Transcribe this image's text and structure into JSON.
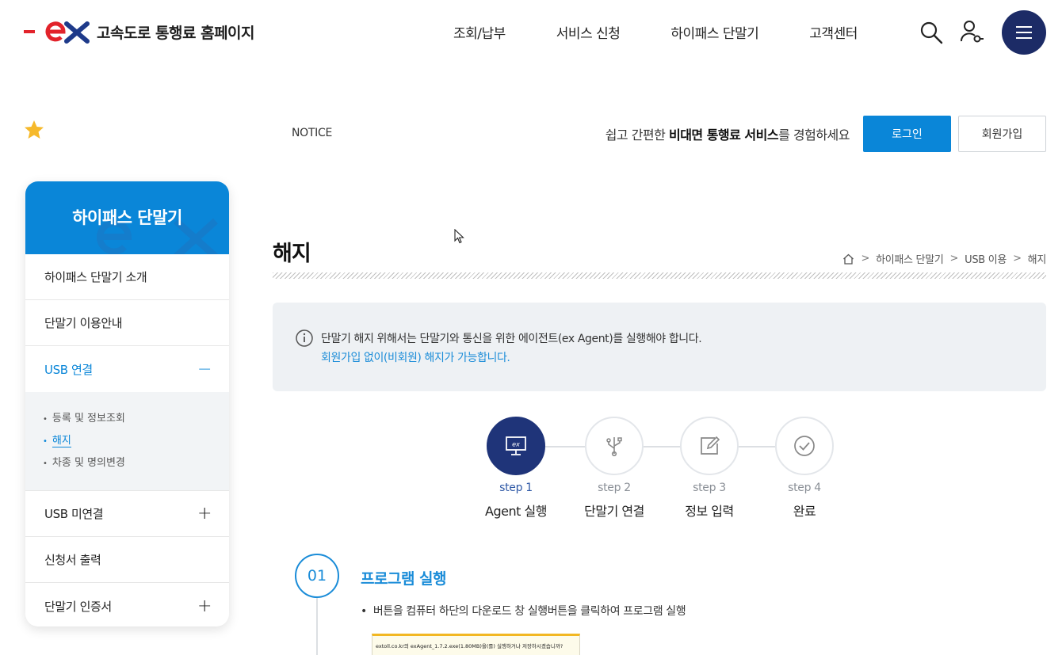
{
  "header": {
    "logo_text": "고속도로 통행료 홈페이지",
    "logo_colors": {
      "red": "#e2232b",
      "blue": "#1e3a8a"
    },
    "nav": [
      "조회/납부",
      "서비스 신청",
      "하이패스 단말기",
      "고객센터"
    ],
    "icons": [
      "search-icon",
      "user-key-icon",
      "menu-icon"
    ],
    "menu_button_color": "#1c2b66"
  },
  "notice": {
    "label": "NOTICE",
    "message_prefix": "쉽고 간편한 ",
    "message_bold": "비대면 통행료 서비스",
    "message_suffix": "를 경험하세요",
    "login_label": "로그인",
    "join_label": "회원가입",
    "accent": "#0a86d8"
  },
  "sidebar": {
    "title": "하이패스 단말기",
    "items": [
      {
        "label": "하이패스 단말기 소개",
        "toggle": ""
      },
      {
        "label": "단말기 이용안내",
        "toggle": ""
      },
      {
        "label": "USB 연결",
        "toggle": "−"
      },
      {
        "label": "USB 미연결",
        "toggle": "+"
      },
      {
        "label": "신청서 출력",
        "toggle": ""
      },
      {
        "label": "단말기 인증서",
        "toggle": "+"
      }
    ],
    "submenu": [
      "등록 및 정보조회",
      "해지",
      "차종 및 명의변경"
    ],
    "current_sub": "해지"
  },
  "page": {
    "title": "해지",
    "breadcrumb": [
      "하이패스 단말기",
      "USB 이용",
      "해지"
    ]
  },
  "info": {
    "line1": "단말기 해지 위해서는 단말기와 통신을 위한 에이전트(ex Agent)를 실행해야 합니다.",
    "line2": "회원가입 없이(비회원) 해지가 가능합니다."
  },
  "steps": [
    {
      "num": "step 1",
      "name": "Agent 실행",
      "icon": "ex-monitor-icon",
      "active": true
    },
    {
      "num": "step 2",
      "name": "단말기 연결",
      "icon": "usb-icon",
      "active": false
    },
    {
      "num": "step 3",
      "name": "정보 입력",
      "icon": "edit-icon",
      "active": false
    },
    {
      "num": "step 4",
      "name": "완료",
      "icon": "check-circle-icon",
      "active": false
    }
  ],
  "section": {
    "number": "01",
    "title": "프로그램 실행",
    "bullet": "버튼을 컴퓨터 하단의 다운로드 창 실행버튼을 클릭하여 프로그램 실행",
    "download_bar_text": "extoll.co.kr의 exAgent_1.7.2.exe(1.80MB)을(를) 실행하거나 저장하시겠습니까?"
  }
}
